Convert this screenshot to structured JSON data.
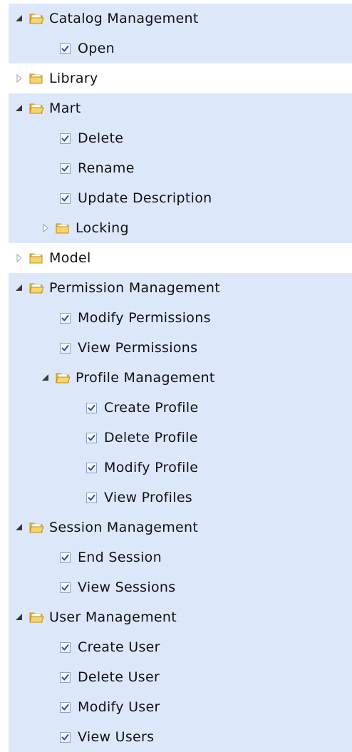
{
  "tree": {
    "nodes": [
      {
        "label": "Catalog Management",
        "kind": "folder",
        "depth": 0,
        "expanded": true,
        "selected": true
      },
      {
        "label": "Open",
        "kind": "check",
        "depth": 1,
        "checked": true,
        "selected": true
      },
      {
        "label": "Library",
        "kind": "folder",
        "depth": 0,
        "expanded": false,
        "selected": false
      },
      {
        "label": "Mart",
        "kind": "folder",
        "depth": 0,
        "expanded": true,
        "selected": true
      },
      {
        "label": "Delete",
        "kind": "check",
        "depth": 1,
        "checked": true,
        "selected": true
      },
      {
        "label": "Rename",
        "kind": "check",
        "depth": 1,
        "checked": true,
        "selected": true
      },
      {
        "label": "Update Description",
        "kind": "check",
        "depth": 1,
        "checked": true,
        "selected": true
      },
      {
        "label": "Locking",
        "kind": "folder",
        "depth": 1,
        "expanded": false,
        "selected": true
      },
      {
        "label": "Model",
        "kind": "folder",
        "depth": 0,
        "expanded": false,
        "selected": false
      },
      {
        "label": "Permission Management",
        "kind": "folder",
        "depth": 0,
        "expanded": true,
        "selected": true
      },
      {
        "label": "Modify Permissions",
        "kind": "check",
        "depth": 1,
        "checked": true,
        "selected": true
      },
      {
        "label": "View Permissions",
        "kind": "check",
        "depth": 1,
        "checked": true,
        "selected": true
      },
      {
        "label": "Profile Management",
        "kind": "folder",
        "depth": 1,
        "expanded": true,
        "selected": true
      },
      {
        "label": "Create Profile",
        "kind": "check",
        "depth": 2,
        "checked": true,
        "selected": true
      },
      {
        "label": "Delete Profile",
        "kind": "check",
        "depth": 2,
        "checked": true,
        "selected": true
      },
      {
        "label": "Modify Profile",
        "kind": "check",
        "depth": 2,
        "checked": true,
        "selected": true
      },
      {
        "label": "View Profiles",
        "kind": "check",
        "depth": 2,
        "checked": true,
        "selected": true
      },
      {
        "label": "Session Management",
        "kind": "folder",
        "depth": 0,
        "expanded": true,
        "selected": true
      },
      {
        "label": "End Session",
        "kind": "check",
        "depth": 1,
        "checked": true,
        "selected": true
      },
      {
        "label": "View Sessions",
        "kind": "check",
        "depth": 1,
        "checked": true,
        "selected": true
      },
      {
        "label": "User Management",
        "kind": "folder",
        "depth": 0,
        "expanded": true,
        "selected": true
      },
      {
        "label": "Create User",
        "kind": "check",
        "depth": 1,
        "checked": true,
        "selected": true
      },
      {
        "label": "Delete User",
        "kind": "check",
        "depth": 1,
        "checked": true,
        "selected": true
      },
      {
        "label": "Modify User",
        "kind": "check",
        "depth": 1,
        "checked": true,
        "selected": true
      },
      {
        "label": "View Users",
        "kind": "check",
        "depth": 1,
        "checked": true,
        "selected": true
      }
    ],
    "icons": {
      "expanded": "expanded-arrow-icon",
      "collapsed": "collapsed-arrow-icon",
      "folder": "folder-icon",
      "checkbox": "checkbox-checked-icon"
    },
    "colors": {
      "selection_bg": "#dce7fa",
      "folder_fill": "#f6d66a",
      "check_mark": "#2a4f9c"
    }
  }
}
